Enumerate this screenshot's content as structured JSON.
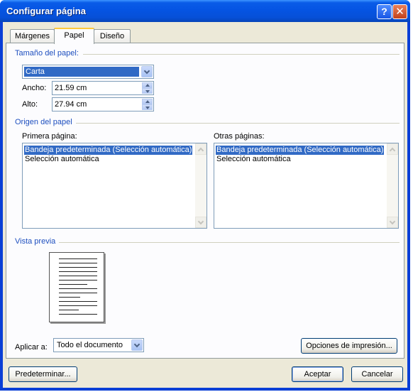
{
  "window": {
    "title": "Configurar página",
    "help_glyph": "?",
    "close_glyph": "✕"
  },
  "tabs": [
    {
      "label": "Márgenes",
      "active": false
    },
    {
      "label": "Papel",
      "active": true
    },
    {
      "label": "Diseño",
      "active": false
    }
  ],
  "paper_size": {
    "group_title": "Tamaño del papel:",
    "selected": "Carta",
    "width_label": "Ancho:",
    "width_value": "21.59 cm",
    "height_label": "Alto:",
    "height_value": "27.94 cm"
  },
  "paper_source": {
    "group_title": "Origen del papel",
    "first_page_label": "Primera página:",
    "other_pages_label": "Otras páginas:",
    "first_page_items": [
      {
        "label": "Bandeja predeterminada (Selección automática)",
        "selected": true
      },
      {
        "label": "Selección automática",
        "selected": false
      }
    ],
    "other_pages_items": [
      {
        "label": "Bandeja predeterminada (Selección automática)",
        "selected": true
      },
      {
        "label": "Selección automática",
        "selected": false
      }
    ]
  },
  "preview": {
    "group_title": "Vista previa"
  },
  "apply": {
    "label": "Aplicar a:",
    "selected": "Todo el documento"
  },
  "buttons": {
    "print_options": "Opciones de impresión...",
    "default": "Predeterminar...",
    "ok": "Aceptar",
    "cancel": "Cancelar"
  },
  "colors": {
    "titlebar": "#0554e3",
    "selection": "#316ac5",
    "group_title": "#1e4fbf",
    "dialog_bg": "#ece9d8"
  },
  "icons": [
    "help-icon",
    "close-icon",
    "dropdown-arrow-icon",
    "spin-up-icon",
    "spin-down-icon",
    "scroll-up-icon",
    "scroll-down-icon"
  ]
}
